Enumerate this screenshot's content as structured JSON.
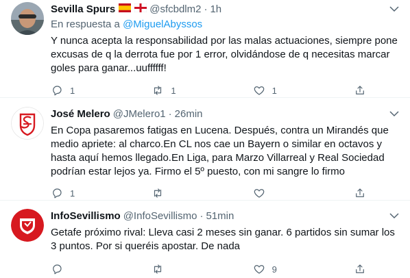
{
  "tweets": [
    {
      "name": "Sevilla Spurs",
      "handle": "@sfcbdlm2",
      "separator": "·",
      "time": "1h",
      "reply_prefix": "En respuesta a",
      "reply_mention": "@MiguelAbyssos",
      "text": "Y nunca acepta la responsabilidad por las malas actuaciones, siempre pone excusas de q la derrota fue por 1 error, olvidándose de q necesitas marcar goles para ganar...uuffffff!",
      "replies": "1",
      "retweets": "1",
      "likes": "1"
    },
    {
      "name": "José Melero",
      "handle": "@JMelero1",
      "separator": "·",
      "time": "26min",
      "text": "En Copa pasaremos fatigas en Lucena. Después, contra un Mirandés que medio apriete: al charco.En CL nos cae un Bayern o similar en octavos y hasta aquí hemos llegado.En Liga, para Marzo Villarreal y Real Sociedad podrían estar lejos ya. Firmo el 5º puesto, con mi sangre lo firmo",
      "replies": "1",
      "retweets": "",
      "likes": ""
    },
    {
      "name": "InfoSevillismo",
      "handle": "@InfoSevillismo",
      "separator": "·",
      "time": "51min",
      "text": "Getafe próximo rival: Lleva casi 2 meses sin ganar. 6 partidos sin sumar los 3 puntos. Por si queréis apostar. De nada",
      "replies": "",
      "retweets": "",
      "likes": "9"
    }
  ],
  "colors": {
    "text": "#0f1419",
    "secondary": "#536471",
    "link": "#1d9bf0",
    "divider": "#eff3f4",
    "sevilla_red": "#d71920"
  },
  "icons": [
    "chevron-down-icon",
    "reply-icon",
    "retweet-icon",
    "like-icon",
    "share-icon",
    "spain-flag-icon",
    "england-flag-icon"
  ]
}
